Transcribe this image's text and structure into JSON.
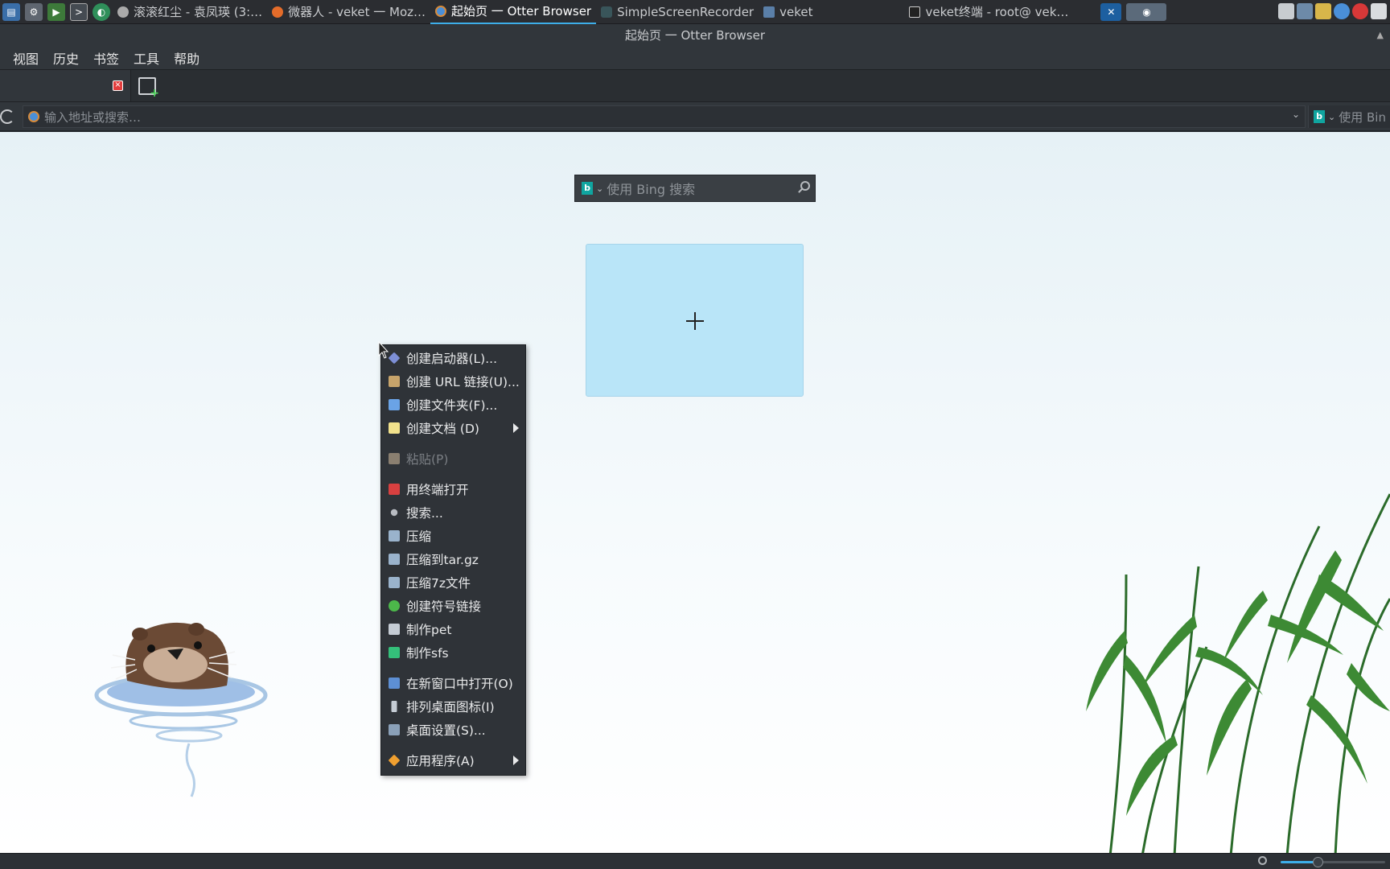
{
  "taskbar": {
    "tasks": [
      {
        "label": "滚滚红尘 - 袁凤瑛 (3:…",
        "icon": "music-icon"
      },
      {
        "label": "微器人 - veket 一 Moz…",
        "icon": "firefox-icon"
      },
      {
        "label": "起始页 一 Otter Browser",
        "icon": "otter-browser-icon"
      },
      {
        "label": "SimpleScreenRecorder",
        "icon": "recorder-icon"
      },
      {
        "label": "veket",
        "icon": "folder-icon"
      },
      {
        "label": "veket终端 - root@ vek…",
        "icon": "terminal-icon"
      }
    ]
  },
  "window": {
    "title": "起始页 一 Otter Browser"
  },
  "menubar": {
    "items": [
      "视图",
      "历史",
      "书签",
      "工具",
      "帮助"
    ]
  },
  "addressbar": {
    "placeholder": "输入地址或搜索…",
    "search_placeholder": "使用 Bin"
  },
  "start_page": {
    "search_placeholder": "使用 Bing 搜索"
  },
  "context_menu": {
    "items": [
      {
        "label": "创建启动器(L)...",
        "icon": "launcher-icon",
        "color": "#7d8fd6"
      },
      {
        "label": "创建 URL 链接(U)...",
        "icon": "url-link-icon",
        "color": "#c7a46b"
      },
      {
        "label": "创建文件夹(F)...",
        "icon": "folder-icon",
        "color": "#6aa3e6"
      },
      {
        "label": "创建文档 (D)",
        "icon": "document-icon",
        "color": "#f2e28c",
        "submenu": true
      },
      {
        "label": "粘贴(P)",
        "icon": "paste-icon",
        "color": "#8a7f70",
        "disabled": true
      },
      {
        "label": "用终端打开",
        "icon": "terminal-icon",
        "color": "#d84040"
      },
      {
        "label": "搜索...",
        "icon": "search-icon",
        "color": "#b8bcc2"
      },
      {
        "label": "压缩",
        "icon": "archive-icon",
        "color": "#9ab3cc"
      },
      {
        "label": "压缩到tar.gz",
        "icon": "archive-icon",
        "color": "#9ab3cc"
      },
      {
        "label": "压缩7z文件",
        "icon": "archive-icon",
        "color": "#9ab3cc"
      },
      {
        "label": "创建符号链接",
        "icon": "symlink-icon",
        "color": "#4cb84a"
      },
      {
        "label": "制作pet",
        "icon": "computer-icon",
        "color": "#c5ccd4"
      },
      {
        "label": "制作sfs",
        "icon": "package-icon",
        "color": "#34c07a"
      },
      {
        "label": "在新窗口中打开(O)",
        "icon": "new-window-icon",
        "color": "#5d8fd4"
      },
      {
        "label": "排列桌面图标(I)",
        "icon": "sort-icon",
        "color": "#c5ccd4"
      },
      {
        "label": "桌面设置(S)...",
        "icon": "desktop-settings-icon",
        "color": "#8aa0b8"
      },
      {
        "label": "应用程序(A)",
        "icon": "applications-icon",
        "color": "#f0a030",
        "submenu": true
      }
    ]
  },
  "statusbar": {
    "zoom": 0.35
  },
  "colors": {
    "accent": "#3daee9",
    "speed_dial": "#b9e5f8",
    "menu_bg": "#2f3338"
  }
}
